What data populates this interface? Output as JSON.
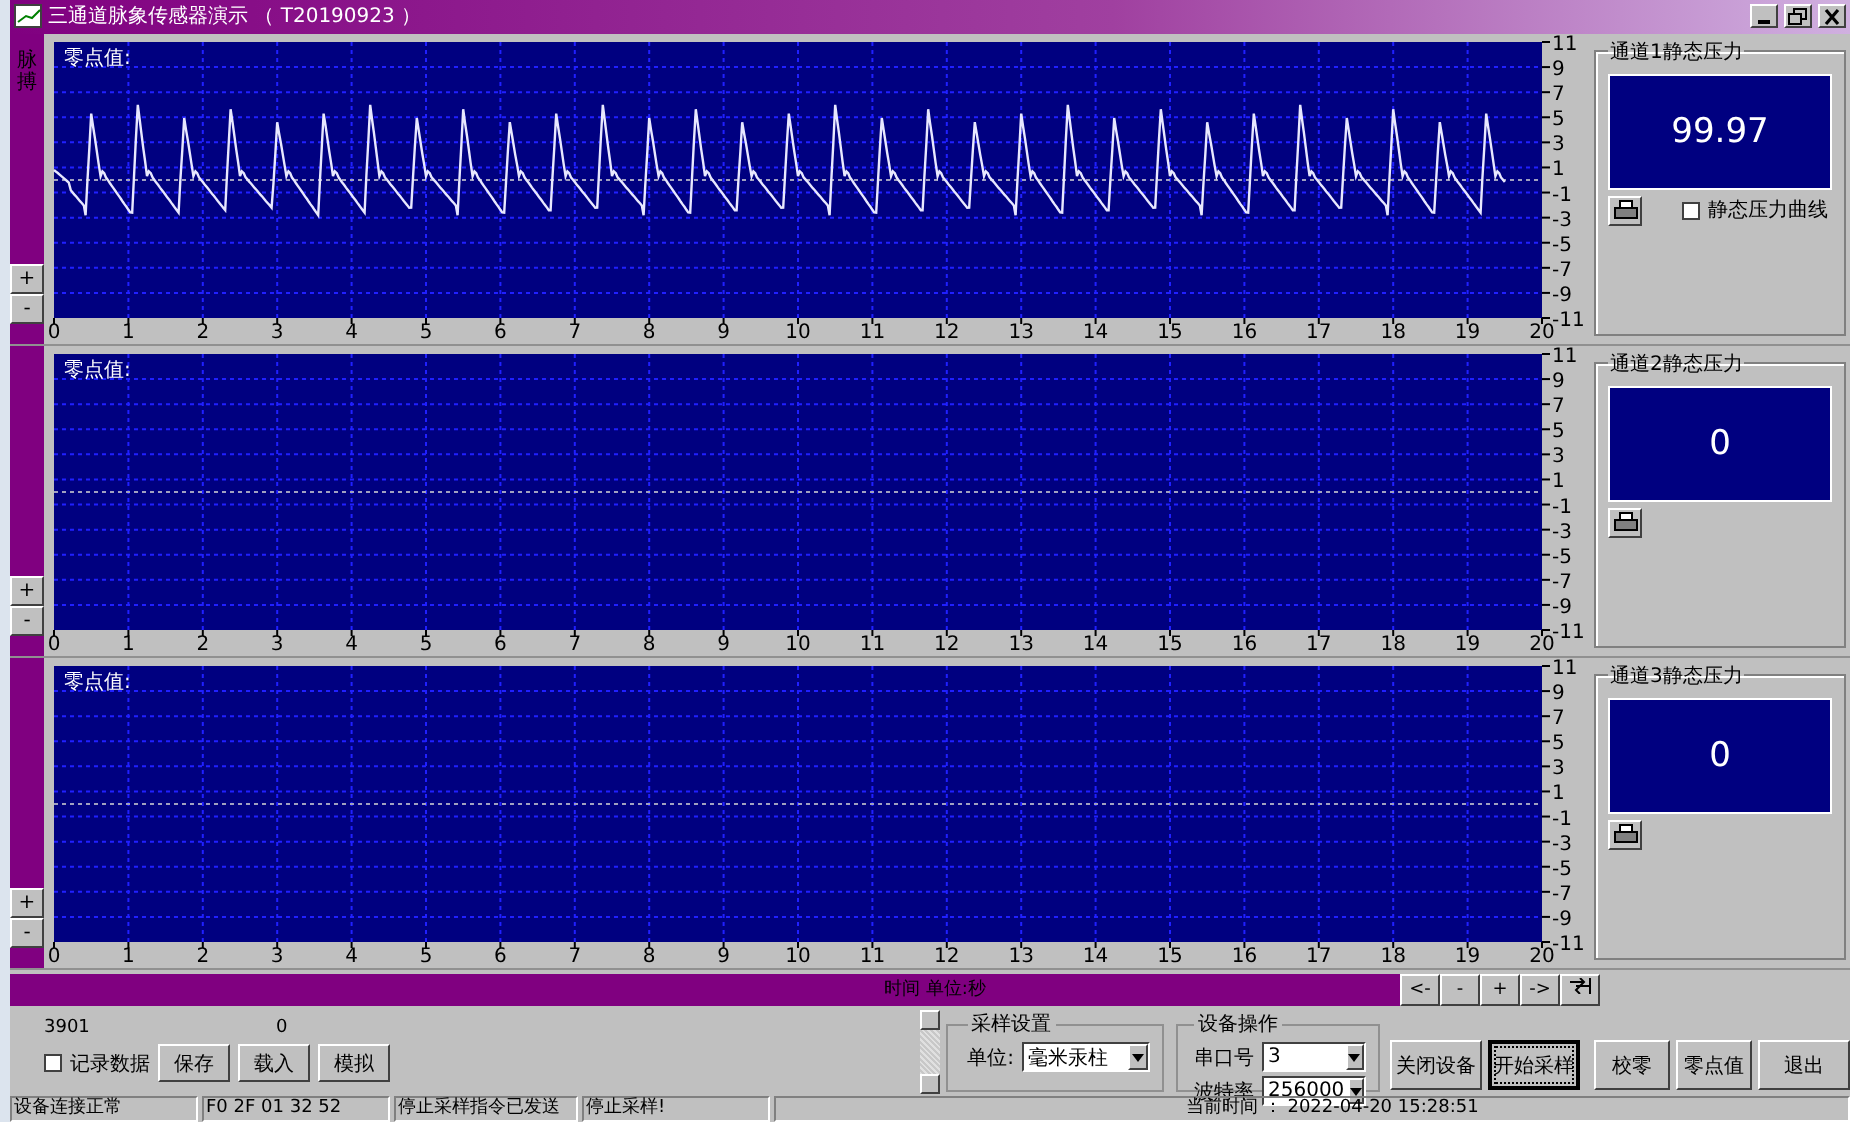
{
  "window": {
    "title": "三通道脉象传感器演示 （ T20190923 ）"
  },
  "channels": [
    {
      "side_label": "脉搏",
      "zoom_buttons": [
        "+",
        "-"
      ],
      "zero_label": "零点值:",
      "signal": true,
      "x_ticks": [
        "0",
        "1",
        "2",
        "3",
        "4",
        "5",
        "6",
        "7",
        "8",
        "9",
        "10",
        "11",
        "12",
        "13",
        "14",
        "15",
        "16",
        "17",
        "18",
        "19",
        "20"
      ],
      "y_ticks": [
        "11",
        "9",
        "7",
        "5",
        "3",
        "1",
        "-1",
        "-3",
        "-5",
        "-7",
        "-9",
        "-11"
      ],
      "panel_title": "通道1静态压力",
      "reading": "99.97",
      "curve_toggle": {
        "label": "静态压力曲线",
        "checked": false
      }
    },
    {
      "zoom_buttons": [
        "+",
        "-"
      ],
      "zero_label": "零点值:",
      "signal": false,
      "x_ticks": [
        "0",
        "1",
        "2",
        "3",
        "4",
        "5",
        "6",
        "7",
        "8",
        "9",
        "10",
        "11",
        "12",
        "13",
        "14",
        "15",
        "16",
        "17",
        "18",
        "19",
        "20"
      ],
      "y_ticks": [
        "11",
        "9",
        "7",
        "5",
        "3",
        "1",
        "-1",
        "-3",
        "-5",
        "-7",
        "-9",
        "-11"
      ],
      "panel_title": "通道2静态压力",
      "reading": "0"
    },
    {
      "zoom_buttons": [
        "+",
        "-"
      ],
      "zero_label": "零点值:",
      "signal": false,
      "x_ticks": [
        "0",
        "1",
        "2",
        "3",
        "4",
        "5",
        "6",
        "7",
        "8",
        "9",
        "10",
        "11",
        "12",
        "13",
        "14",
        "15",
        "16",
        "17",
        "18",
        "19",
        "20"
      ],
      "y_ticks": [
        "11",
        "9",
        "7",
        "5",
        "3",
        "1",
        "-1",
        "-3",
        "-5",
        "-7",
        "-9",
        "-11"
      ],
      "panel_title": "通道3静态压力",
      "reading": "0"
    }
  ],
  "time_bar": {
    "label": "时间 单位:秒",
    "nav_buttons": [
      "<-",
      "-",
      "+",
      "->"
    ]
  },
  "counters": [
    "3901",
    "0"
  ],
  "record": {
    "label": "记录数据",
    "checked": false
  },
  "file_buttons": [
    "保存",
    "载入",
    "模拟"
  ],
  "sampling": {
    "title": "采样设置",
    "unit_label": "单位:",
    "unit": "毫米汞柱"
  },
  "device": {
    "title": "设备操作",
    "port_label": "串口号",
    "port": "3",
    "baud_label": "波特率",
    "baud": "256000"
  },
  "action_buttons": [
    {
      "label": "关闭设备",
      "focused": false
    },
    {
      "label": "开始采样",
      "focused": true
    },
    {
      "label": "校零",
      "focused": false
    },
    {
      "label": "零点值",
      "focused": false
    },
    {
      "label": "退出",
      "focused": false
    }
  ],
  "status_bar": [
    "设备连接正常",
    "F0 2F 01 32 52",
    "停止采样指令已发送",
    "停止采样!",
    "当前时间 ： 2022-04-20 15:28:51"
  ]
}
